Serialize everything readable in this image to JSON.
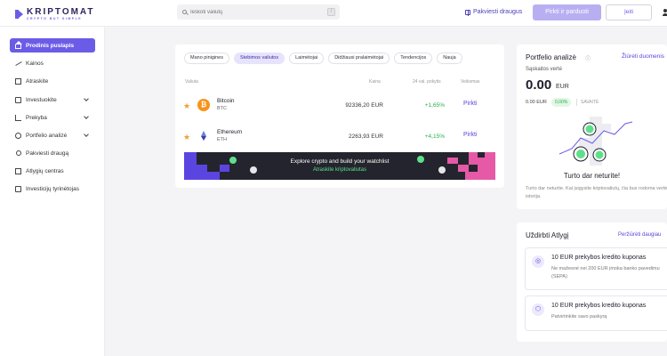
{
  "brand": {
    "name": "KRIPTOMAT",
    "tagline": "CRYPTO BUT SIMPLE"
  },
  "header": {
    "search_placeholder": "Ieškoti valiutų",
    "search_shortcut": "/",
    "invite_label": "Pakviesti draugus",
    "buysell_label": "Pirkti ir parduoti",
    "login_label": "Įeiti"
  },
  "sidebar": {
    "items": [
      {
        "label": "Prodinis puslapis",
        "icon": "home-icon",
        "active": true
      },
      {
        "label": "Kainos",
        "icon": "trend-icon"
      },
      {
        "label": "Atraskite",
        "icon": "grid-icon"
      },
      {
        "label": "Investuokite",
        "icon": "wallet-icon",
        "expandable": true
      },
      {
        "label": "Prekyba",
        "icon": "cart-icon",
        "expandable": true
      },
      {
        "label": "Portfelio analizė",
        "icon": "pie-icon",
        "expandable": true
      },
      {
        "label": "Pakviesti draugą",
        "icon": "people-icon"
      },
      {
        "label": "Atlygių centras",
        "icon": "gift-icon"
      },
      {
        "label": "Investicijų tyrinėtojas",
        "icon": "book-icon"
      }
    ]
  },
  "watchlist": {
    "tabs": [
      {
        "label": "Mano pinigines",
        "active": false
      },
      {
        "label": "Stebimos valiutos",
        "active": true
      },
      {
        "label": "Laimėtojai",
        "active": false
      },
      {
        "label": "Didžiausi pralaimėtojai",
        "active": false
      },
      {
        "label": "Tendencijos",
        "active": false
      },
      {
        "label": "Nauja",
        "active": false
      }
    ],
    "columns": {
      "currency": "Valiuta",
      "price": "Kaina",
      "change": "24 val. pokytis",
      "actions": "Veiksmas"
    },
    "rows": [
      {
        "name": "Bitcoin",
        "symbol": "BTC",
        "price": "92336,20 EUR",
        "change": "+1,65%",
        "action": "Pirkti",
        "coin_color": "#f7931a"
      },
      {
        "name": "Ethereum",
        "symbol": "ETH",
        "price": "2263,93 EUR",
        "change": "+4,15%",
        "action": "Pirkti",
        "coin_color": "#627eea"
      }
    ],
    "banner": {
      "title": "Explore crypto and build your watchlist",
      "link": "Atraskite kriptovaliutas"
    }
  },
  "portfolio": {
    "title": "Portfelio analizė",
    "link": "Žiūrėti duomenis",
    "account_label": "Sąskaitos vertė",
    "value": "0.00",
    "currency": "EUR",
    "sub_value": "0.00 EUR",
    "change_pill": "0,00%",
    "period": "SAVAITĖ",
    "empty_title": "Turto dar neturite!",
    "empty_text": "Turto dar neturite. Kai įsigysite kriptovaliutų, čia bus rodoma vertės istorija."
  },
  "rewards": {
    "title": "Uždirbti Atlygį",
    "link": "Peržiūrėti daugiau",
    "items": [
      {
        "name": "10 EUR prekybos kredito kuponas",
        "desc": "Ne mažesnė nei 200 EUR įmoka banko pavedimu (SEPA)"
      },
      {
        "name": "10 EUR prekybos kredito kuponas",
        "desc": "Patvirtinkite savo paskyrą"
      }
    ]
  }
}
